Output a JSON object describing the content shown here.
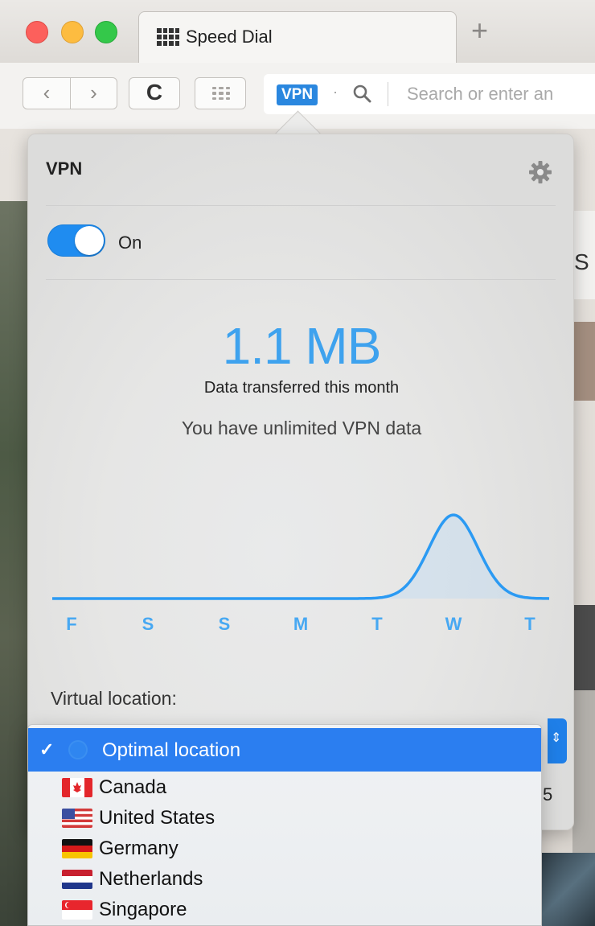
{
  "browser": {
    "tab_title": "Speed Dial",
    "new_tab_symbol": "+",
    "back_symbol": "‹",
    "forward_symbol": "›",
    "reload_symbol": "C",
    "vpn_badge": "VPN",
    "address_placeholder": "Search or enter an"
  },
  "vpn_panel": {
    "title": "VPN",
    "toggle_label": "On",
    "toggle_on": true,
    "data_amount": "1.1 MB",
    "data_caption": "Data transferred this month",
    "data_limit_text": "You have unlimited VPN data",
    "virtual_location_label": "Virtual location:"
  },
  "chart_data": {
    "type": "line",
    "categories": [
      "F",
      "S",
      "S",
      "M",
      "T",
      "W",
      "T"
    ],
    "values": [
      0,
      0,
      0,
      0,
      0,
      1.1,
      0
    ],
    "title": "",
    "xlabel": "",
    "ylabel": "",
    "series_color": "#2b9af3"
  },
  "location_list": {
    "items": [
      {
        "label": "Optimal location",
        "selected": true,
        "icon": "globe-icon"
      },
      {
        "label": "Canada",
        "selected": false,
        "icon": "flag-canada-icon"
      },
      {
        "label": "United States",
        "selected": false,
        "icon": "flag-us-icon"
      },
      {
        "label": "Germany",
        "selected": false,
        "icon": "flag-germany-icon"
      },
      {
        "label": "Netherlands",
        "selected": false,
        "icon": "flag-netherlands-icon"
      },
      {
        "label": "Singapore",
        "selected": false,
        "icon": "flag-singapore-icon"
      }
    ]
  },
  "background": {
    "right_letter": "S",
    "bottom_number": "5"
  },
  "colors": {
    "accent_blue": "#1f8cf0",
    "selected_row": "#2b7ef0",
    "data_blue": "#3ea2ee"
  }
}
